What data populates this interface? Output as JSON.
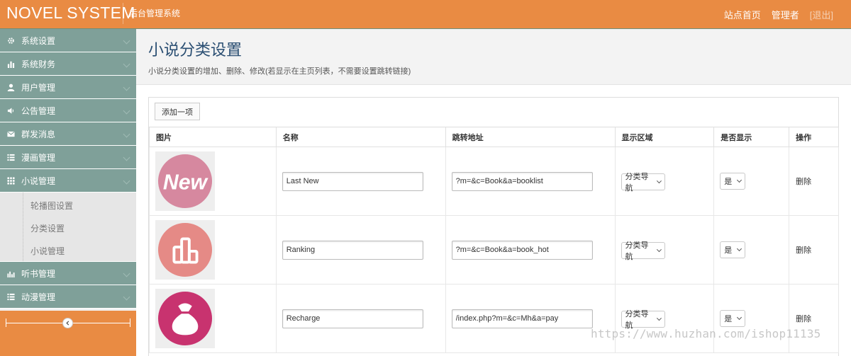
{
  "header": {
    "brand": "NOVEL SYSTEM",
    "subtitle": "后台管理系统",
    "nav": {
      "home": "站点首页",
      "user": "管理者",
      "logout": "[退出]"
    }
  },
  "sidebar": {
    "items": [
      {
        "label": "系统设置",
        "icon": "gear-icon"
      },
      {
        "label": "系统财务",
        "icon": "bar-chart-icon"
      },
      {
        "label": "用户管理",
        "icon": "user-icon"
      },
      {
        "label": "公告管理",
        "icon": "speaker-icon"
      },
      {
        "label": "群发消息",
        "icon": "envelope-icon"
      },
      {
        "label": "漫画管理",
        "icon": "list-icon"
      },
      {
        "label": "小说管理",
        "icon": "grid-icon"
      },
      {
        "label": "听书管理",
        "icon": "equalizer-icon"
      },
      {
        "label": "动漫管理",
        "icon": "list-icon"
      }
    ],
    "novel_submenu": [
      "轮播图设置",
      "分类设置",
      "小说管理"
    ]
  },
  "page": {
    "title": "小说分类设置",
    "subtitle": "小说分类设置的增加、删除、修改(若显示在主页列表，不需要设置跳转链接)",
    "add_button": "添加一项"
  },
  "table": {
    "columns": [
      "图片",
      "名称",
      "跳转地址",
      "显示区域",
      "是否显示",
      "操作"
    ],
    "rows": [
      {
        "image": "new-logo-icon",
        "image_text": "New",
        "name": "Last New",
        "url": "?m=&c=Book&a=booklist",
        "area": "分类导航",
        "show": "是",
        "action": "删除"
      },
      {
        "image": "ranking-icon",
        "name": "Ranking",
        "url": "?m=&c=Book&a=book_hot",
        "area": "分类导航",
        "show": "是",
        "action": "删除"
      },
      {
        "image": "money-bag-icon",
        "name": "Recharge",
        "url": "/index.php?m=&c=Mh&a=pay",
        "area": "分类导航",
        "show": "是",
        "action": "删除"
      }
    ]
  },
  "watermark": "https://www.huzhan.com/ishop11135",
  "colors": {
    "header": "#e98b43",
    "sidebar": "#7fa099",
    "title": "#2a4e72"
  }
}
